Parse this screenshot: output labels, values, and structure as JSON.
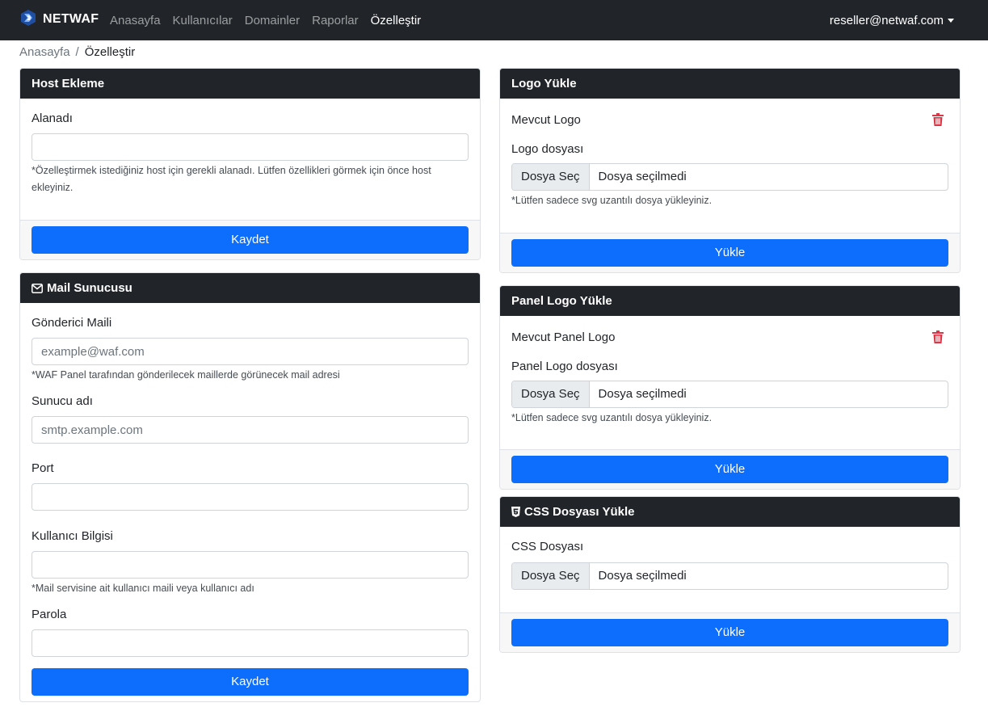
{
  "navbar": {
    "brand": "NETWAF",
    "links": [
      "Anasayfa",
      "Kullanıcılar",
      "Domainler",
      "Raporlar",
      "Özelleştir"
    ],
    "active_index": 4,
    "user": "reseller@netwaf.com"
  },
  "breadcrumb": {
    "home": "Anasayfa",
    "separator": "/",
    "current": "Özelleştir"
  },
  "host_card": {
    "title": "Host Ekleme",
    "field_label": "Alanadı",
    "field_value": "",
    "hint": "*Özelleştirmek istediğiniz host için gerekli alanadı. Lütfen özellikleri görmek için önce host ekleyiniz.",
    "button": "Kaydet"
  },
  "mail_card": {
    "title": "Mail Sunucusu",
    "icon": "envelope-icon",
    "sender_label": "Gönderici Maili",
    "sender_placeholder": "example@waf.com",
    "sender_hint": "*WAF Panel tarafından gönderilecek maillerde görünecek mail adresi",
    "server_label": "Sunucu adı",
    "server_placeholder": "smtp.example.com",
    "port_label": "Port",
    "user_label": "Kullanıcı Bilgisi",
    "user_hint": "*Mail servisine ait kullanıcı maili veya kullanıcı adı",
    "password_label": "Parola",
    "button": "Kaydet"
  },
  "logo_card": {
    "title": "Logo Yükle",
    "current_label": "Mevcut Logo",
    "file_label": "Logo dosyası",
    "file_button": "Dosya Seç",
    "file_status": "Dosya seçilmedi",
    "hint": "*Lütfen sadece svg uzantılı dosya yükleyiniz.",
    "button": "Yükle"
  },
  "panel_logo_card": {
    "title": "Panel Logo Yükle",
    "current_label": "Mevcut Panel Logo",
    "file_label": "Panel Logo dosyası",
    "file_button": "Dosya Seç",
    "file_status": "Dosya seçilmedi",
    "hint": "*Lütfen sadece svg uzantılı dosya yükleyiniz.",
    "button": "Yükle"
  },
  "css_card": {
    "title": "CSS Dosyası Yükle",
    "icon": "css3-icon",
    "file_label": "CSS Dosyası",
    "file_button": "Dosya Seç",
    "file_status": "Dosya seçilmedi",
    "button": "Yükle"
  },
  "colors": {
    "navbar_bg": "#212529",
    "primary": "#0d6efd",
    "danger": "#dc3545",
    "footer_bg": "#f7f7f7"
  }
}
